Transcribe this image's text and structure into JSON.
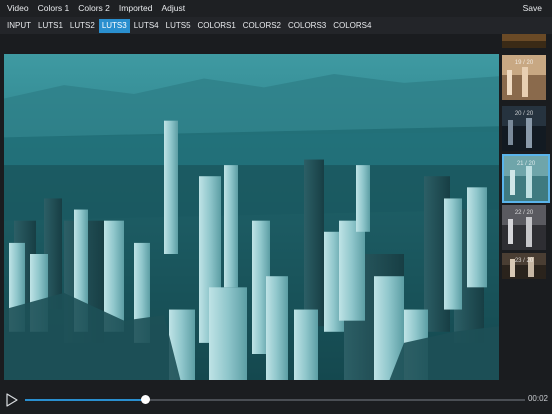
{
  "menu": {
    "items": [
      "Video",
      "Colors 1",
      "Colors 2",
      "Imported",
      "Adjust"
    ],
    "save_label": "Save"
  },
  "tabs": {
    "items": [
      "INPUT",
      "LUTS1",
      "LUTS2",
      "LUTS3",
      "LUTS4",
      "LUTS5",
      "COLORS1",
      "COLORS2",
      "COLORS3",
      "COLORS4"
    ],
    "active": "LUTS3"
  },
  "thumbnails": {
    "labels": [
      "",
      "19 / 20",
      "20 / 20",
      "21 / 20",
      "22 / 20",
      "23 / 20"
    ],
    "selected_index": 3
  },
  "player": {
    "current_time": "00:02",
    "progress": 0.24
  },
  "colors": {
    "accent": "#2a8fcf",
    "selected_border": "#5ab4ea",
    "preview_tint": "#1e7f89"
  }
}
